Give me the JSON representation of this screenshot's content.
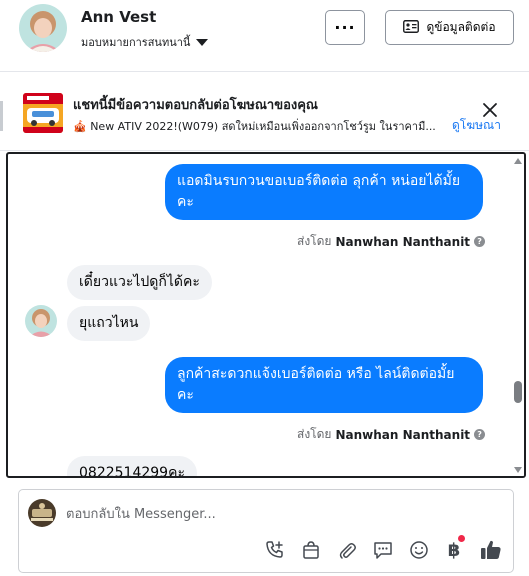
{
  "header": {
    "contact_name": "Ann Vest",
    "assign_label": "มอบหมายการสนทนานี้",
    "more_label": "···",
    "info_label": "ดูข้อมูลติดต่อ"
  },
  "ad_banner": {
    "title": "แชทนี้มีข้อความตอบกลับต่อโฆษณาของคุณ",
    "description": "🎪 New ATIV 2022!(W079) สดใหม่เหมือนเพิ่งออกจากโชว์รูม ในราคามื...",
    "link_label": "ดูโฆษณา"
  },
  "messages": [
    {
      "direction": "out",
      "text": "แอดมินรบกวนขอเบอร์ติดต่อ ลุกค้า  หน่อยได้มั้ยคะ"
    },
    {
      "direction": "in",
      "text": "เดี๋ยวแวะไปดูก็ได้คะ"
    },
    {
      "direction": "in",
      "text": "ยุแถวไหน"
    },
    {
      "direction": "out",
      "text": "ลูกค้าสะดวกแจ้งเบอร์ติดต่อ หรือ ไลน์ติดต่อมั้ยคะ"
    },
    {
      "direction": "in",
      "text": "0822514299คะ"
    }
  ],
  "sent_by": {
    "prefix": "ส่งโดย",
    "name": "Nanwhan Nanthanit",
    "help": "?"
  },
  "composer": {
    "placeholder": "ตอบกลับใน Messenger...",
    "baht_symbol": "฿"
  },
  "colors": {
    "accent": "#1877f2",
    "outgoing_bubble": "#0a7cff",
    "incoming_bubble": "#f0f2f5",
    "notification_dot": "#f02849"
  },
  "icons": [
    "more-icon",
    "contact-card-icon",
    "close-icon",
    "help-icon",
    "call-add-icon",
    "shopping-bag-icon",
    "attachment-icon",
    "saved-replies-icon",
    "emoji-icon",
    "payment-icon",
    "thumbs-up-icon"
  ]
}
